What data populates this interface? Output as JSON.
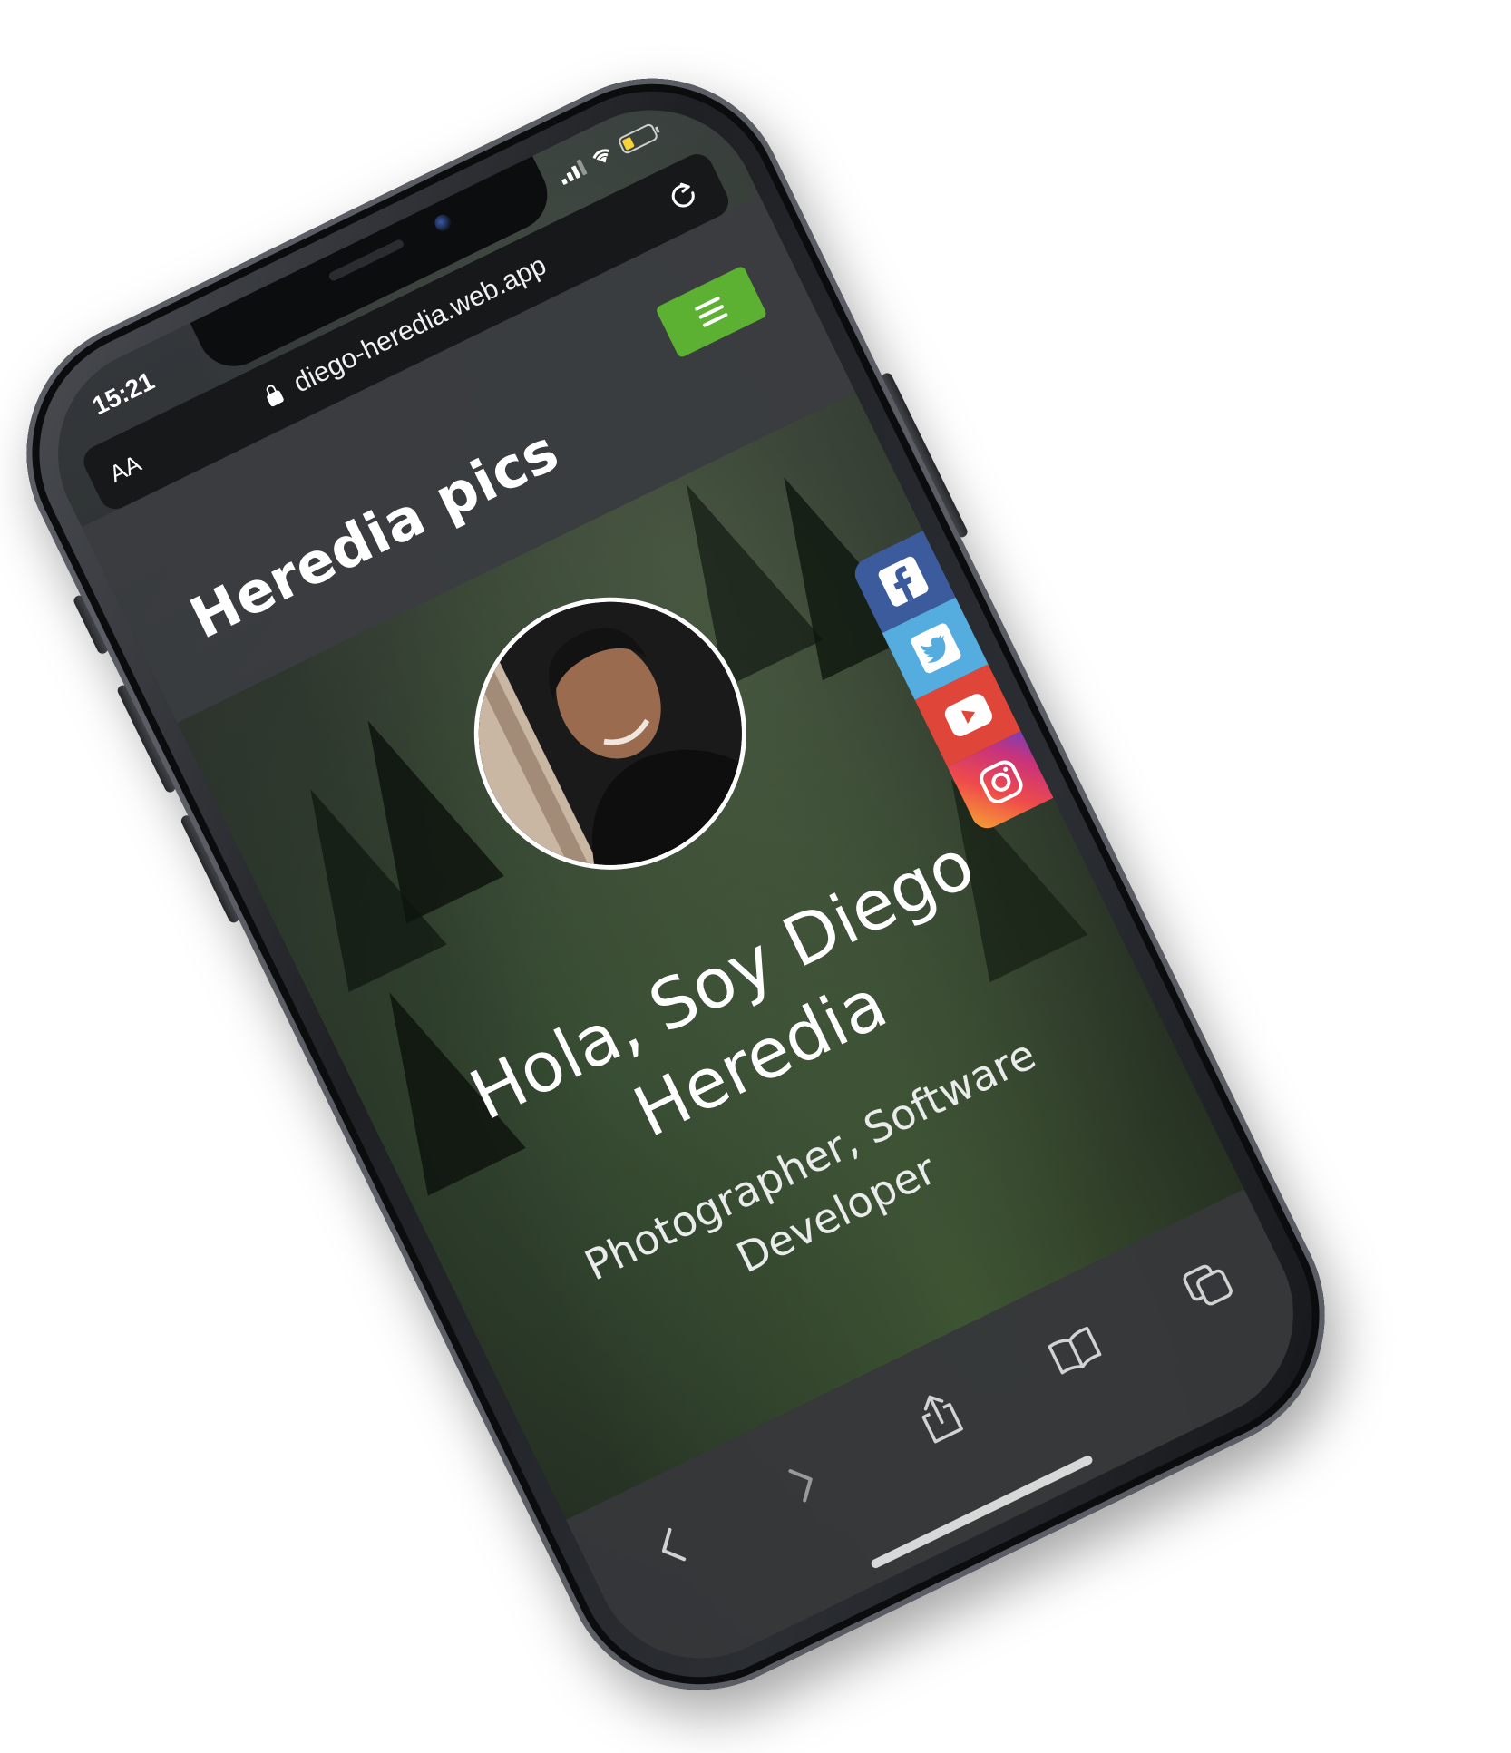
{
  "status_bar": {
    "time": "15:21",
    "icons": [
      "cellular-signal-icon",
      "wifi-icon",
      "battery-icon"
    ],
    "battery_level": 0.3
  },
  "browser": {
    "text_size_label": "AA",
    "url": "diego-heredia.web.app",
    "lock_icon": "lock-icon",
    "reload_icon": "reload-icon",
    "toolbar_icons": [
      "back-icon",
      "forward-icon",
      "share-icon",
      "bookmarks-icon",
      "tabs-icon"
    ]
  },
  "site": {
    "title": "Heredia pics",
    "menu_icon": "hamburger-menu-icon",
    "menu_color": "#5cb032",
    "hero_title": "Hola, Soy Diego Heredia",
    "hero_subtitle": "Photographer, Software Developer",
    "social_links": [
      {
        "name": "facebook",
        "icon": "facebook-icon",
        "color": "#3b5b9c"
      },
      {
        "name": "twitter",
        "icon": "twitter-icon",
        "color": "#55acdf"
      },
      {
        "name": "youtube",
        "icon": "youtube-icon",
        "color": "#e0453a"
      },
      {
        "name": "instagram",
        "icon": "instagram-icon",
        "color": "#d6336c"
      }
    ]
  }
}
